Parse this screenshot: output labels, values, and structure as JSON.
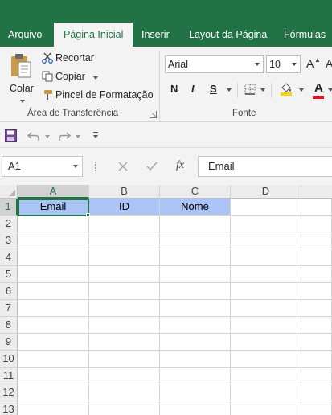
{
  "tabs": [
    {
      "label": "Arquivo",
      "active": false
    },
    {
      "label": "Página Inicial",
      "active": true
    },
    {
      "label": "Inserir",
      "active": false
    },
    {
      "label": "Layout da Página",
      "active": false
    },
    {
      "label": "Fórmulas",
      "active": false
    }
  ],
  "ribbon": {
    "clipboard": {
      "paste_label": "Colar",
      "cut_label": "Recortar",
      "copy_label": "Copiar",
      "format_painter_label": "Pincel de Formatação",
      "group_label": "Área de Transferência"
    },
    "font": {
      "font_name": "Arial",
      "font_size": "10",
      "bold_label": "N",
      "italic_label": "I",
      "underline_label": "S",
      "grow_label": "A",
      "font_color_label": "A",
      "group_label": "Fonte"
    }
  },
  "formula_bar": {
    "name_box": "A1",
    "fx_label": "fx",
    "content": "Email"
  },
  "sheet": {
    "columns": [
      "A",
      "B",
      "C",
      "D"
    ],
    "rows": [
      "1",
      "2",
      "3",
      "4",
      "5",
      "6",
      "7",
      "8",
      "9",
      "10",
      "11",
      "12",
      "13"
    ],
    "row1": [
      "Email",
      "ID",
      "Nome"
    ],
    "selected_cell": "A1"
  },
  "colors": {
    "brand": "#217346",
    "header_fill": "#a9c4f5",
    "font_color": "#e81123",
    "highlight": "#ffd500"
  },
  "icons": [
    "save-icon",
    "undo-icon",
    "redo-icon",
    "customize-qat-icon",
    "paste-icon",
    "cut-icon",
    "copy-icon",
    "format-painter-icon",
    "borders-icon",
    "fill-color-icon",
    "font-color-icon",
    "cancel-icon",
    "enter-icon",
    "fx-icon"
  ]
}
